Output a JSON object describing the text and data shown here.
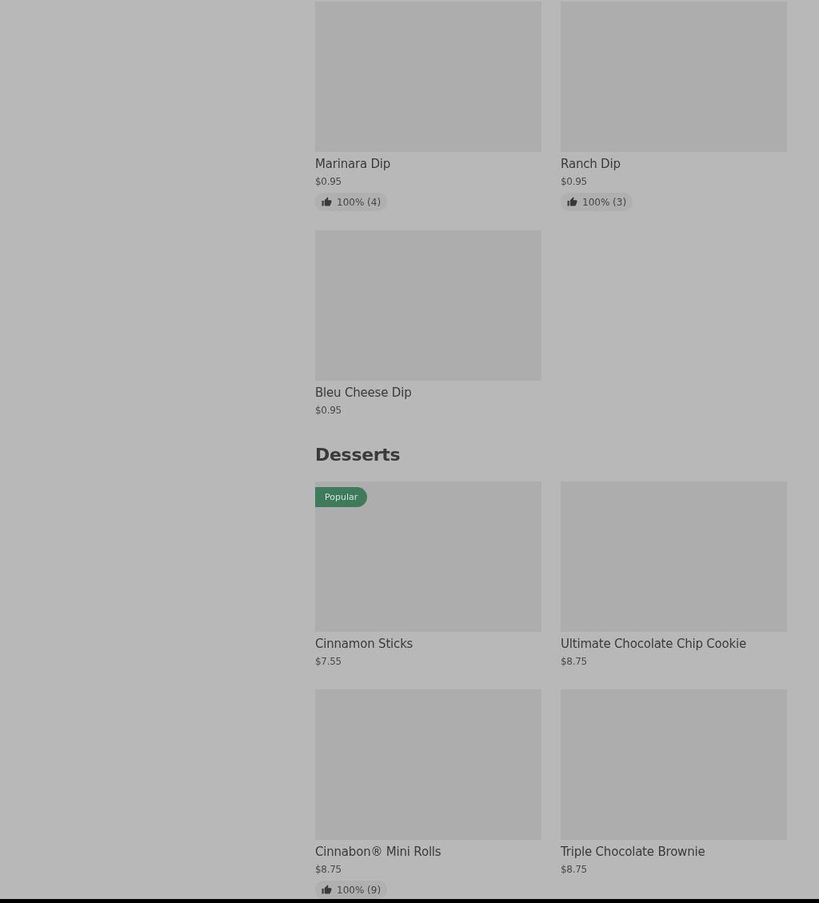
{
  "sections": [
    {
      "items": [
        {
          "name": "Marinara Dip",
          "price": "$0.95",
          "rating": "100% (4)"
        },
        {
          "name": "Ranch Dip",
          "price": "$0.95",
          "rating": "100% (3)"
        },
        {
          "name": "Bleu Cheese Dip",
          "price": "$0.95"
        }
      ]
    },
    {
      "title": "Desserts",
      "items": [
        {
          "name": "Cinnamon Sticks",
          "price": "$7.55",
          "badge": "Popular"
        },
        {
          "name": "Ultimate Chocolate Chip Cookie",
          "price": "$8.75"
        },
        {
          "name": "Cinnabon® Mini Rolls",
          "price": "$8.75",
          "rating": "100% (9)"
        },
        {
          "name": "Triple Chocolate Brownie",
          "price": "$8.75"
        }
      ]
    }
  ]
}
